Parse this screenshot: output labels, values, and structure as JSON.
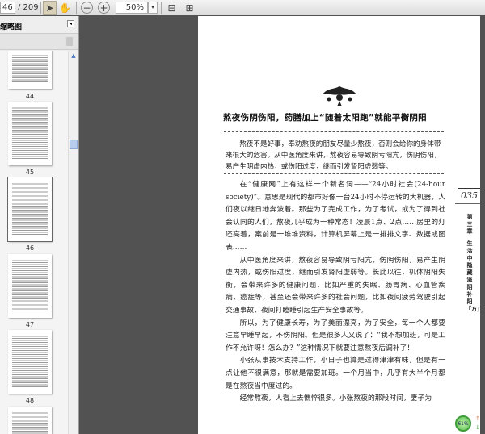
{
  "toolbar": {
    "page_current": "46",
    "page_total": "/ 209",
    "zoom": "50%",
    "zoom_dropdown": "▾"
  },
  "sidebar": {
    "title": "缩略图",
    "collapse": "◂",
    "scroll_up": "▲",
    "thumbnails": [
      {
        "label": "44"
      },
      {
        "label": "45"
      },
      {
        "label": "46"
      },
      {
        "label": "47"
      },
      {
        "label": "48"
      }
    ]
  },
  "document": {
    "title": "熬夜伤阴伤阳，药膳加上“随着太阳跑”就能平衡阴阳",
    "abstract": "熬夜不是好事，奉劝熬夜的朋友尽量少熬夜，否则会给你的身体带来很大的危害。从中医角度来讲，熬夜容易导致阴亏阳亢，伤阴伤阳，易产生阴虚内热，或伤阳过度，继而引发肾阳虚弱等。",
    "paragraphs": [
      "在“健康网”上有这样一个新名词——“24小时社会(24-hour society)”。意思是现代的都市好像一台24小时不停运转的大机器，人们夜以继日地奔波着。那些为了完成工作，为了考试，或为了得到社会认同的人们，熬夜几乎成为一种常态！凌晨1点、2点……房里的灯还亮着，案前是一堆堆资料，计算机屏幕上是一排排文字、数据或图表……",
      "从中医角度来讲，熬夜容易导致阴亏阳亢，伤阴伤阳，易产生阴虚内热，或伤阳过度，继而引发肾阳虚弱等。长此以往，机体阴阳失衡，会带来许多的健康问题，比如严重的失眠、肠胃病、心血管疾病、癌症等，甚至还会带来许多的社会问题，比如夜间疲劳驾驶引起交通事故、夜间打瞌睡引起生产安全事故等。",
      "所以，为了健康长寿，为了美丽漂亮，为了安全，每一个人都要注意早睡早起，不伤阴阳。但是很多人又说了：“我不想加班，可是工作不允许呀！怎么办？”这种情况下就要注意熬夜后调补了！",
      "小张从事技术支持工作，小日子也算是过得津津有味，但是有一点让他不很满意，那就是需要加班。一个月当中，几乎有大半个月都是在熬夜当中度过的。",
      "经常熬夜，人看上去憔悴很多。小张熬夜的那段时间，妻子为"
    ],
    "page_number": "035",
    "chapter": "第三章",
    "chapter_title": "生活中隐藏滋阴补阳「方」"
  },
  "widget": {
    "percent": "61%",
    "up": "↑",
    "down": "↓"
  }
}
